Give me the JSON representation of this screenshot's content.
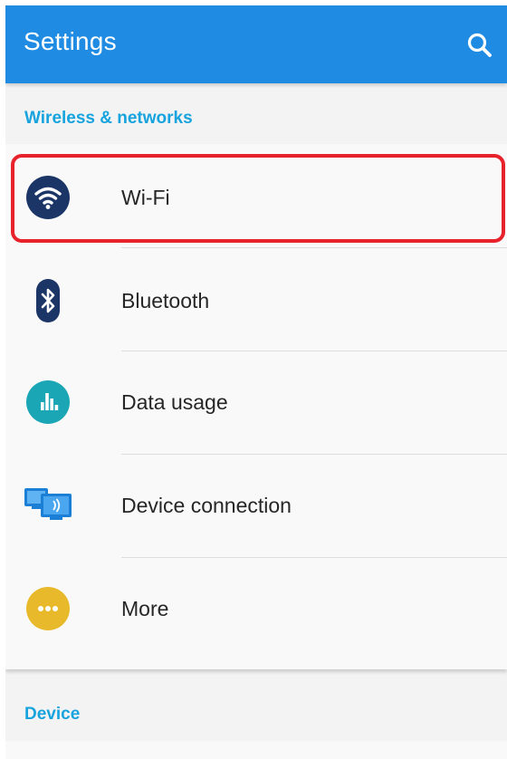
{
  "appbar": {
    "title": "Settings",
    "search_icon": "search-icon",
    "background": "#1f8be3"
  },
  "sections": {
    "wireless": {
      "header": "Wireless & networks",
      "items": [
        {
          "label": "Wi-Fi",
          "icon": "wifi-icon",
          "highlighted": true
        },
        {
          "label": "Bluetooth",
          "icon": "bluetooth-icon"
        },
        {
          "label": "Data usage",
          "icon": "data-usage-icon"
        },
        {
          "label": "Device connection",
          "icon": "device-connection-icon"
        },
        {
          "label": "More",
          "icon": "more-icon"
        }
      ]
    },
    "device": {
      "header": "Device"
    }
  },
  "colors": {
    "accent": "#17a3de",
    "highlight": "#e8222a",
    "wifi_icon": "#1c3567",
    "bluetooth_icon": "#1c3567",
    "data_usage_icon": "#1aa6b5",
    "device_connection_icon": "#1b7fd6",
    "more_icon": "#e8b92a"
  }
}
